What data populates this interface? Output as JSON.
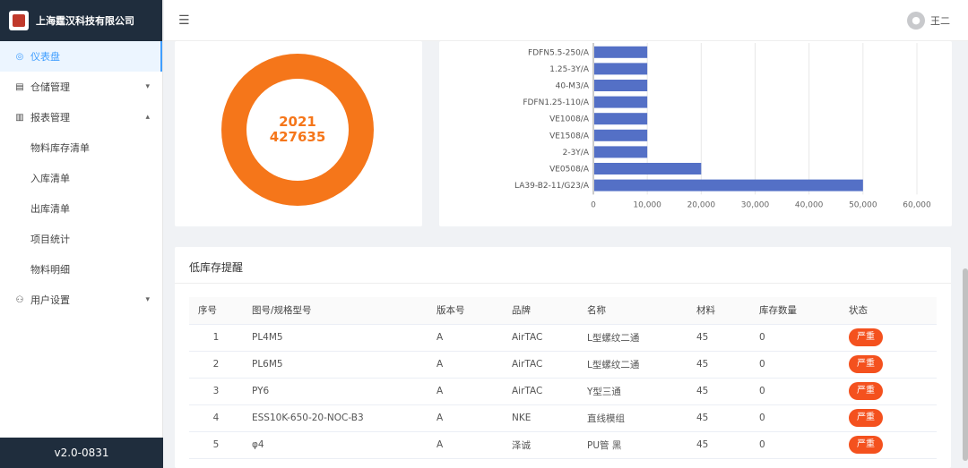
{
  "brand": {
    "name": "上海霆汉科技有限公司"
  },
  "sidebar": {
    "items": [
      {
        "label": "仪表盘"
      },
      {
        "label": "仓储管理"
      },
      {
        "label": "报表管理"
      },
      {
        "label": "用户设置"
      }
    ],
    "report_sub": [
      {
        "label": "物料库存清单"
      },
      {
        "label": "入库清单"
      },
      {
        "label": "出库清单"
      },
      {
        "label": "项目统计"
      },
      {
        "label": "物料明细"
      }
    ],
    "version": "v2.0-0831"
  },
  "header": {
    "user": "王二"
  },
  "donut": {
    "line1": "2021",
    "line2": "427635",
    "color": "#f5761a"
  },
  "chart_data": {
    "type": "bar",
    "orientation": "horizontal",
    "categories": [
      "FDFN5.5-250/A",
      "1.25-3Y/A",
      "40-M3/A",
      "FDFN1.25-110/A",
      "VE1008/A",
      "VE1508/A",
      "2-3Y/A",
      "VE0508/A",
      "LA39-B2-11/G23/A"
    ],
    "values": [
      10000,
      10000,
      10000,
      10000,
      10000,
      10000,
      10000,
      20000,
      50000
    ],
    "xlim": [
      0,
      60000
    ],
    "xticks": [
      "0",
      "10,000",
      "20,000",
      "30,000",
      "40,000",
      "50,000",
      "60,000"
    ],
    "bar_color": "#5470c6",
    "grid": true
  },
  "table": {
    "title": "低库存提醒",
    "headers": [
      "序号",
      "图号/规格型号",
      "版本号",
      "品牌",
      "名称",
      "材料",
      "库存数量",
      "状态"
    ],
    "rows": [
      {
        "no": "1",
        "model": "PL4M5",
        "version": "A",
        "brand": "AirTAC",
        "name": "L型螺纹二通",
        "material": "45",
        "qty": "0",
        "status": "严重"
      },
      {
        "no": "2",
        "model": "PL6M5",
        "version": "A",
        "brand": "AirTAC",
        "name": "L型螺纹二通",
        "material": "45",
        "qty": "0",
        "status": "严重"
      },
      {
        "no": "3",
        "model": "PY6",
        "version": "A",
        "brand": "AirTAC",
        "name": "Y型三通",
        "material": "45",
        "qty": "0",
        "status": "严重"
      },
      {
        "no": "4",
        "model": "ESS10K-650-20-NOC-B3",
        "version": "A",
        "brand": "NKE",
        "name": "直线模组",
        "material": "45",
        "qty": "0",
        "status": "严重"
      },
      {
        "no": "5",
        "model": "φ4",
        "version": "A",
        "brand": "泽诚",
        "name": "PU管 黑",
        "material": "45",
        "qty": "0",
        "status": "严重"
      }
    ]
  }
}
